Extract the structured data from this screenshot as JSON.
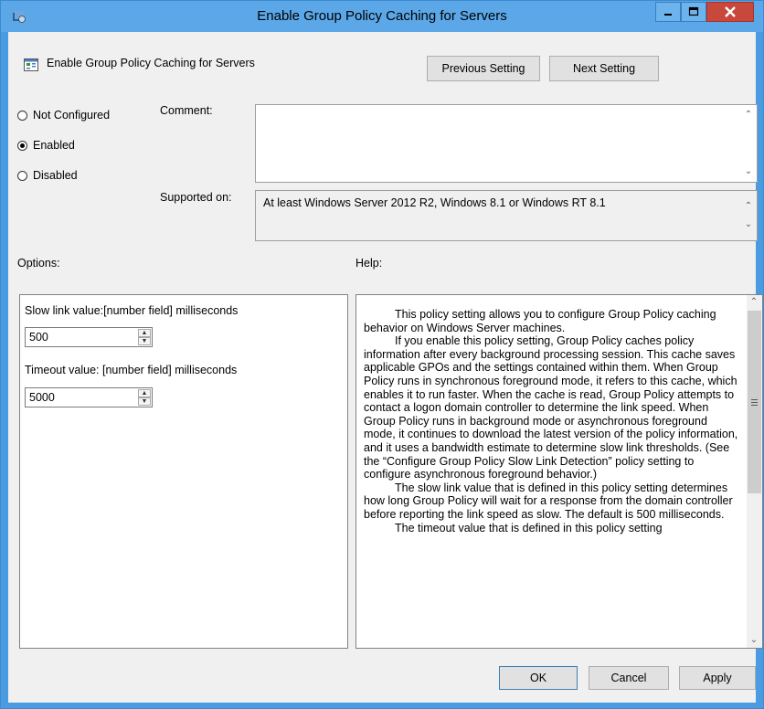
{
  "window": {
    "title": "Enable Group Policy Caching for Servers"
  },
  "header": {
    "setting_name": "Enable Group Policy Caching for Servers",
    "previous_button": "Previous Setting",
    "next_button": "Next Setting"
  },
  "state": {
    "options": [
      {
        "label": "Not Configured",
        "checked": false
      },
      {
        "label": "Enabled",
        "checked": true
      },
      {
        "label": "Disabled",
        "checked": false
      }
    ]
  },
  "comment": {
    "label": "Comment:",
    "value": ""
  },
  "supported": {
    "label": "Supported on:",
    "value": "At least Windows Server 2012 R2, Windows 8.1 or Windows RT 8.1"
  },
  "options_section": {
    "label": "Options:",
    "slow_link_label": "Slow link value:[number field] milliseconds",
    "slow_link_value": "500",
    "timeout_label": "Timeout value: [number field] milliseconds",
    "timeout_value": "5000"
  },
  "help_section": {
    "label": "Help:",
    "paragraphs": [
      "This policy setting allows you to configure Group Policy caching behavior on Windows Server machines.",
      "If you enable this policy setting, Group Policy caches policy information after every background processing session. This cache saves applicable GPOs and the settings contained within them. When Group Policy runs in synchronous foreground mode, it refers to this cache, which enables it to run faster. When the cache is read, Group Policy attempts to contact a logon domain controller to determine the link speed. When Group Policy runs in background mode or asynchronous foreground mode, it continues to download the latest version of the policy information, and it uses a bandwidth estimate to determine slow link thresholds. (See the “Configure Group Policy Slow Link Detection” policy setting to configure asynchronous foreground behavior.)",
      "The slow link value that is defined in this policy setting determines how long Group Policy will wait for a response from the domain controller before reporting the link speed as slow. The default is 500 milliseconds.",
      "The timeout value that is defined in this policy setting"
    ]
  },
  "footer": {
    "ok": "OK",
    "cancel": "Cancel",
    "apply": "Apply"
  },
  "icons": [
    "policy-app-icon",
    "minimize-icon",
    "maximize-icon",
    "close-icon",
    "policy-setting-icon",
    "scroll-up-icon",
    "scroll-down-icon",
    "spin-up-icon",
    "spin-down-icon",
    "scroll-thumb-grip-icon"
  ],
  "colors": {
    "titlebar": "#5ba7e8",
    "close_button": "#c9483c",
    "dialog_background": "#f0f0f0"
  }
}
